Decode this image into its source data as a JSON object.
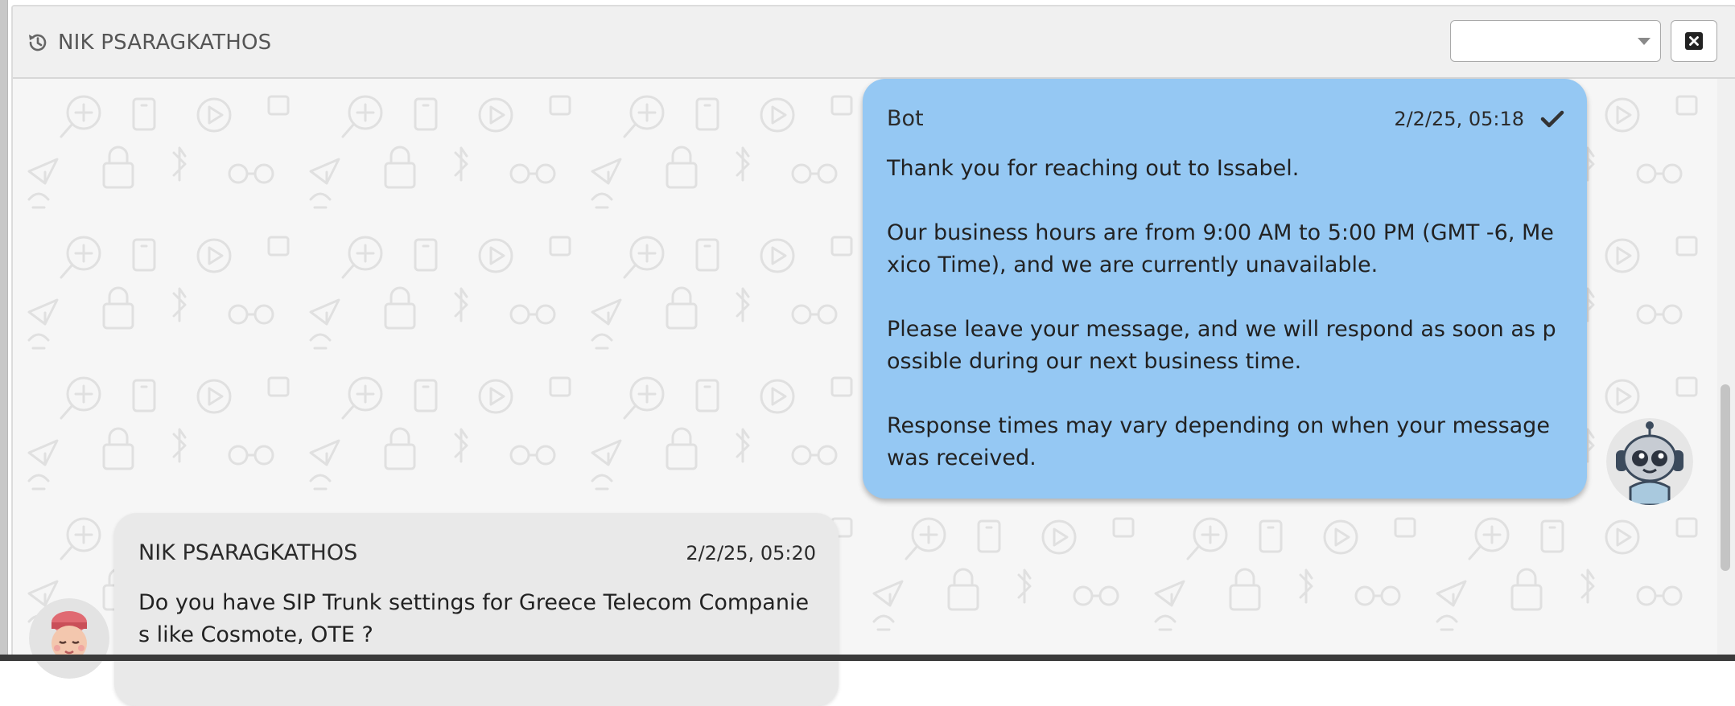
{
  "header": {
    "contact_name": "NIK PSARAGKATHOS",
    "history_icon": "history-icon",
    "select_value": "",
    "close_icon": "close-square-icon"
  },
  "messages": [
    {
      "sender": "Bot",
      "time": "2/2/25, 05:18",
      "status_icon": "check-icon",
      "text": "Thank you for reaching out to Issabel.\n\nOur business hours are from 9:00 AM to 5:00 PM (GMT -6, Mexico Time), and we are currently unavailable.\n\nPlease leave your message, and we will respond as soon as possible during our next business time.\n\nResponse times may vary depending on when your message was received.",
      "bubble_color": "#95c8f3",
      "avatar_icon": "robot-avatar-icon"
    },
    {
      "sender": "NIK PSARAGKATHOS",
      "time": "2/2/25, 05:20",
      "text": "Do you have SIP Trunk settings for Greece Telecom Companies like Cosmote, OTE ?",
      "bubble_color": "#e9e9e9",
      "avatar_icon": "user-avatar-icon"
    }
  ],
  "colors": {
    "header_bg": "#f0f0f0",
    "chat_bg": "#f6f6f6",
    "pattern": "#e0e0e0"
  }
}
